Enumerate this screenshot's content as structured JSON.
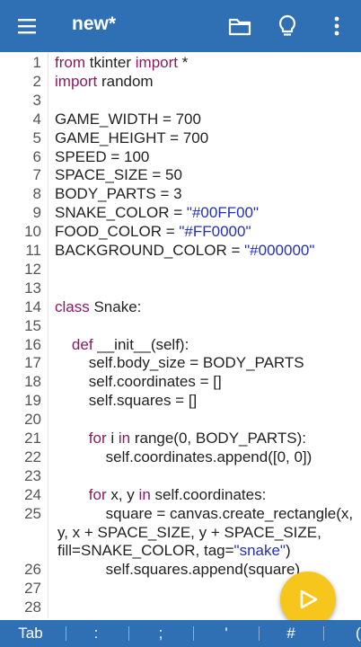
{
  "appbar": {
    "title": "new*",
    "icons": [
      "menu-icon",
      "folder-icon",
      "lightbulb-icon",
      "more-vert-icon"
    ]
  },
  "editor": {
    "lines": [
      {
        "n": "1",
        "parts": [
          {
            "t": "from",
            "c": "kw"
          },
          {
            "t": " tkinter "
          },
          {
            "t": "import",
            "c": "kw"
          },
          {
            "t": " *"
          }
        ]
      },
      {
        "n": "2",
        "parts": [
          {
            "t": "import",
            "c": "kw"
          },
          {
            "t": " random"
          }
        ]
      },
      {
        "n": "3",
        "parts": []
      },
      {
        "n": "4",
        "parts": [
          {
            "t": "GAME_WIDTH = 700"
          }
        ]
      },
      {
        "n": "5",
        "parts": [
          {
            "t": "GAME_HEIGHT = 700"
          }
        ]
      },
      {
        "n": "6",
        "parts": [
          {
            "t": "SPEED = 100"
          }
        ]
      },
      {
        "n": "7",
        "parts": [
          {
            "t": "SPACE_SIZE = 50"
          }
        ]
      },
      {
        "n": "8",
        "parts": [
          {
            "t": "BODY_PARTS = 3"
          }
        ]
      },
      {
        "n": "9",
        "parts": [
          {
            "t": "SNAKE_COLOR = "
          },
          {
            "t": "\"#00FF00\"",
            "c": "str"
          }
        ]
      },
      {
        "n": "10",
        "parts": [
          {
            "t": "FOOD_COLOR = "
          },
          {
            "t": "\"#FF0000\"",
            "c": "str"
          }
        ]
      },
      {
        "n": "11",
        "parts": [
          {
            "t": "BACKGROUND_COLOR = "
          },
          {
            "t": "\"#000000\"",
            "c": "str"
          }
        ]
      },
      {
        "n": "12",
        "parts": []
      },
      {
        "n": "13",
        "parts": []
      },
      {
        "n": "14",
        "parts": [
          {
            "t": "class",
            "c": "kw"
          },
          {
            "t": " Snake:"
          }
        ]
      },
      {
        "n": "15",
        "parts": []
      },
      {
        "n": "16",
        "parts": [
          {
            "t": "    "
          },
          {
            "t": "def",
            "c": "kw"
          },
          {
            "t": " __init__(self):"
          }
        ]
      },
      {
        "n": "17",
        "parts": [
          {
            "t": "        self.body_size = BODY_PARTS"
          }
        ]
      },
      {
        "n": "18",
        "parts": [
          {
            "t": "        self.coordinates = []"
          }
        ]
      },
      {
        "n": "19",
        "parts": [
          {
            "t": "        self.squares = []"
          }
        ]
      },
      {
        "n": "20",
        "parts": []
      },
      {
        "n": "21",
        "parts": [
          {
            "t": "        "
          },
          {
            "t": "for",
            "c": "kw"
          },
          {
            "t": " i "
          },
          {
            "t": "in",
            "c": "kw"
          },
          {
            "t": " range(0, BODY_PARTS):"
          }
        ]
      },
      {
        "n": "22",
        "parts": [
          {
            "t": "            self.coordinates.append([0, 0])"
          }
        ]
      },
      {
        "n": "23",
        "parts": []
      },
      {
        "n": "24",
        "parts": [
          {
            "t": "        "
          },
          {
            "t": "for",
            "c": "kw"
          },
          {
            "t": " x, y "
          },
          {
            "t": "in",
            "c": "kw"
          },
          {
            "t": " self.coordinates:"
          }
        ]
      },
      {
        "n": "25",
        "parts": [
          {
            "t": "            square = canvas.create_rectangle(x,"
          }
        ]
      },
      {
        "n": "",
        "parts": [
          {
            "t": "y, x + SPACE_SIZE, y + SPACE_SIZE,"
          }
        ]
      },
      {
        "n": "",
        "parts": [
          {
            "t": "fill=SNAKE_COLOR, tag="
          },
          {
            "t": "\"snake\"",
            "c": "str"
          },
          {
            "t": ")"
          }
        ]
      },
      {
        "n": "26",
        "parts": [
          {
            "t": "            self.squares.append(square)"
          }
        ]
      },
      {
        "n": "27",
        "parts": []
      },
      {
        "n": "28",
        "parts": []
      }
    ]
  },
  "fab": {
    "icon": "play-icon"
  },
  "keybar": {
    "keys": [
      "Tab",
      ":",
      ";",
      "'",
      "#",
      "("
    ]
  },
  "colors": {
    "appbar": "#2f6fb3",
    "keyword": "#8a1a63",
    "string": "#2330b8",
    "fab": "#f7c61d"
  }
}
